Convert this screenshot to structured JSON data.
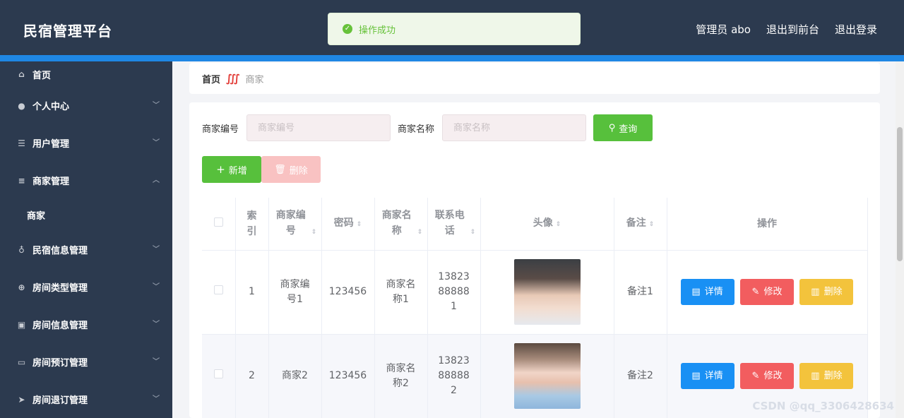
{
  "header": {
    "title": "民宿管理平台",
    "admin_label": "管理员 abo",
    "to_front_label": "退出到前台",
    "logout_label": "退出登录"
  },
  "toast": {
    "text": "操作成功",
    "icon": "check-circle-icon"
  },
  "sidebar": {
    "items": [
      {
        "label": "首页",
        "icon": "home-icon"
      },
      {
        "label": "个人中心",
        "icon": "user-icon"
      },
      {
        "label": "用户管理",
        "icon": "list-icon"
      },
      {
        "label": "商家管理",
        "icon": "menu-icon"
      },
      {
        "label": "商家",
        "icon": ""
      },
      {
        "label": "民宿信息管理",
        "icon": "mic-icon"
      },
      {
        "label": "房间类型管理",
        "icon": "globe-icon"
      },
      {
        "label": "房间信息管理",
        "icon": "clipboard-icon"
      },
      {
        "label": "房间预订管理",
        "icon": "card-icon"
      },
      {
        "label": "房间退订管理",
        "icon": "send-icon"
      }
    ]
  },
  "breadcrumb": {
    "home": "首页",
    "current": "商家"
  },
  "search": {
    "field1_label": "商家编号",
    "field1_placeholder": "商家编号",
    "field2_label": "商家名称",
    "field2_placeholder": "商家名称",
    "query_label": "查询"
  },
  "actions": {
    "add_label": "新增",
    "delete_label": "删除"
  },
  "table": {
    "headers": [
      "索引",
      "商家编号",
      "密码",
      "商家名称",
      "联系电话",
      "头像",
      "备注",
      "操作"
    ],
    "rows": [
      {
        "index": "1",
        "code": "商家编号1",
        "password": "123456",
        "name": "商家名称1",
        "phone": "13823888881",
        "remark": "备注1"
      },
      {
        "index": "2",
        "code": "商家2",
        "password": "123456",
        "name": "商家名称2",
        "phone": "13823888882",
        "remark": "备注2"
      }
    ],
    "op_detail": "详情",
    "op_edit": "修改",
    "op_delete": "删除"
  },
  "watermark": "CSDN @qq_3306428634",
  "colors": {
    "header_bg": "#2c3a4f",
    "accent_blue": "#1f87e4",
    "success_green": "#57c03c",
    "danger_red": "#f25d5f",
    "warning_yellow": "#f3c33c"
  }
}
